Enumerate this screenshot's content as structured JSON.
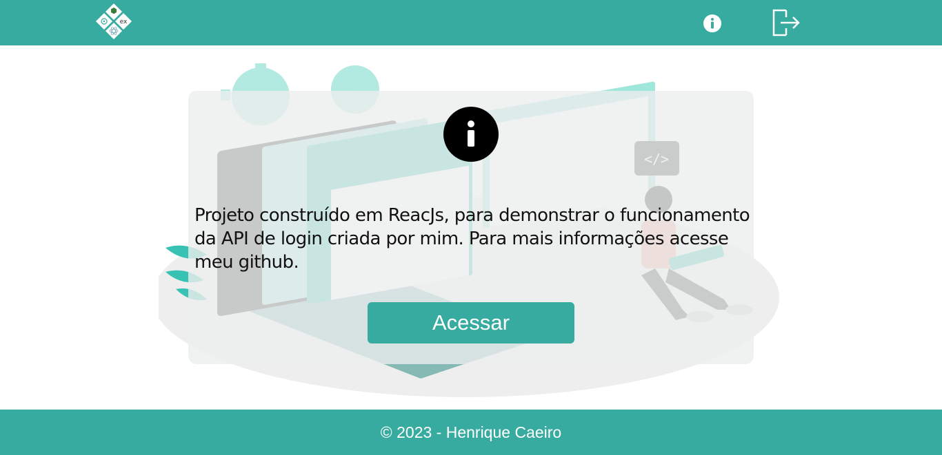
{
  "header": {
    "logo_icon": "node-react-express-logo-icon",
    "info_icon": "info-circle-icon",
    "logout_icon": "logout-icon"
  },
  "illustration": {
    "icon": "developer-laptop-illustration"
  },
  "card": {
    "icon": "info-circle-icon",
    "text": "Projeto construído em ReacJs, para demonstrar o funcionamento da API de login criada por mim. Para mais informações acesse meu github.",
    "button_label": "Acessar"
  },
  "footer": {
    "text": "© 2023 - Henrique Caeiro"
  },
  "colors": {
    "primary": "#37ab9f",
    "card_bg": "#eceeed",
    "accent_light": "#7fe0d3"
  }
}
